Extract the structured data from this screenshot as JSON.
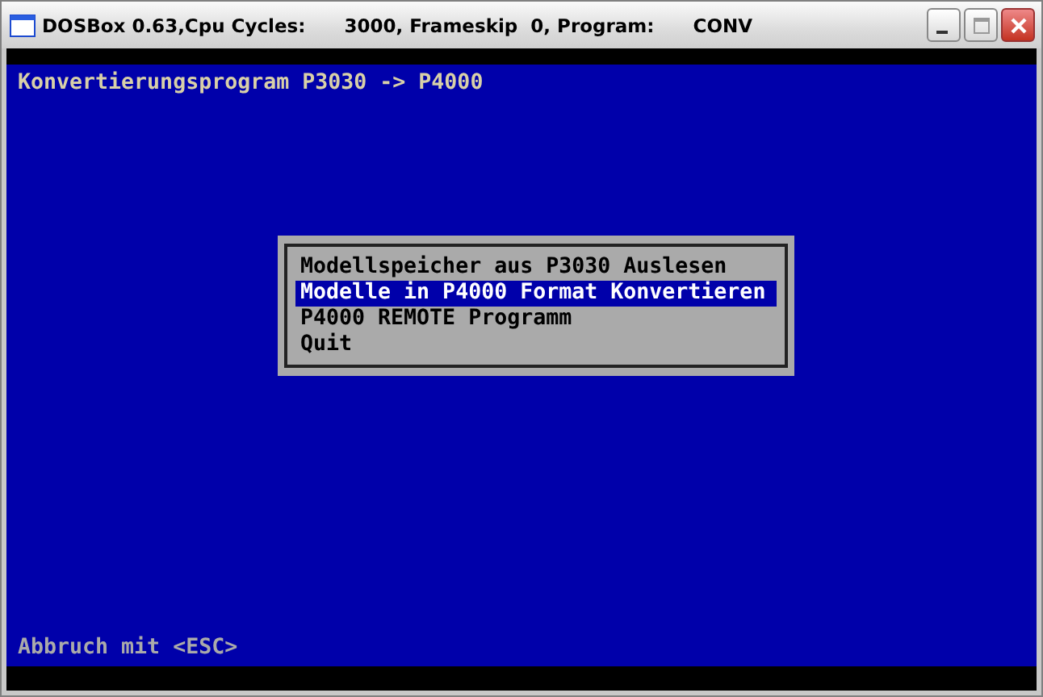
{
  "window": {
    "title": "DOSBox 0.63,Cpu Cycles:      3000, Frameskip  0, Program:      CONV"
  },
  "header": "Konvertierungsprogram P3030 -> P4000",
  "menu": [
    {
      "label": "Modellspeicher aus P3030 Auslesen",
      "selected": false
    },
    {
      "label": "Modelle in P4000 Format Konvertieren",
      "selected": true
    },
    {
      "label": "P4000 REMOTE Programm",
      "selected": false
    },
    {
      "label": "Quit",
      "selected": false
    }
  ],
  "footer": "Abbruch mit <ESC>"
}
